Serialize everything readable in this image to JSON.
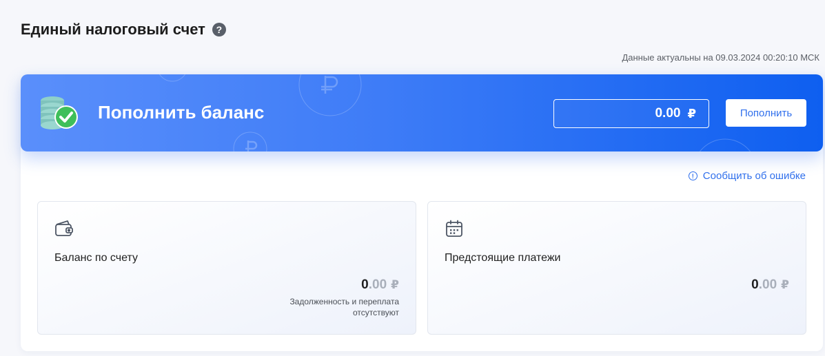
{
  "header": {
    "title": "Единый налоговый счет",
    "help_icon": "question-circle-icon",
    "help_glyph": "?",
    "actual_label": "Данные актуальны на 09.03.2024 00:20:10 МСК"
  },
  "banner": {
    "title": "Пополнить баланс",
    "icon": "coins-check-icon",
    "amount_value": "0.00",
    "currency": "₽",
    "button_label": "Пополнить",
    "colors": {
      "start": "#5a8ffb",
      "end": "#0e5ff0"
    }
  },
  "report": {
    "label": "Сообщить об ошибке",
    "icon": "exclamation-circle-icon",
    "icon_glyph": "!"
  },
  "tiles": [
    {
      "icon": "wallet-icon",
      "label": "Баланс по счету",
      "amount_int": "0",
      "amount_dec": ".00",
      "currency": "₽",
      "note": "Задолженность и переплата отсутствуют"
    },
    {
      "icon": "calendar-icon",
      "label": "Предстоящие платежи",
      "amount_int": "0",
      "amount_dec": ".00",
      "currency": "₽"
    }
  ],
  "colors": {
    "accent": "#2f6fec",
    "muted": "#a9afba"
  }
}
